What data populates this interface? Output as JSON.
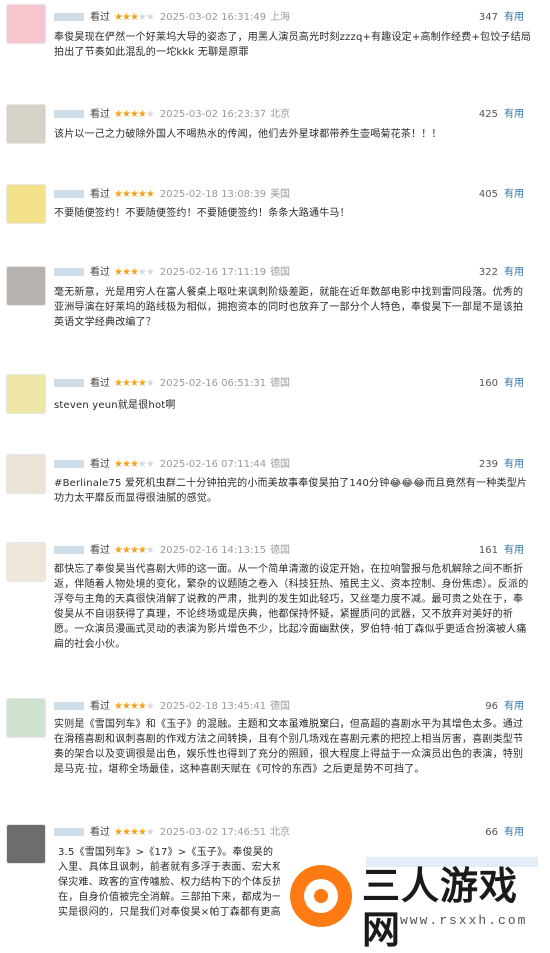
{
  "reviews": [
    {
      "seen": "看过",
      "stars": 3,
      "time": "2025-03-02 16:31:49",
      "loc": "上海",
      "votes": "347",
      "useful": "有用",
      "content": "奉俊昊现在俨然一个好莱坞大导的姿态了，用黑人演员高光时刻zzzq+有趣设定+高制作经费+包饺子结局拍出了节奏如此混乱的一坨kkk 无聊是原罪"
    },
    {
      "seen": "看过",
      "stars": 4,
      "time": "2025-03-02 16:23:37",
      "loc": "北京",
      "votes": "425",
      "useful": "有用",
      "content": "该片以一己之力破除外国人不喝热水的传闻，他们去外星球都带养生壶喝菊花茶！！！"
    },
    {
      "seen": "看过",
      "stars": 5,
      "time": "2025-02-18 13:08:39",
      "loc": "美国",
      "votes": "405",
      "useful": "有用",
      "content": "不要随便签约！不要随便签约！不要随便签约！条条大路通牛马！"
    },
    {
      "seen": "看过",
      "stars": 3,
      "time": "2025-02-16 17:11:19",
      "loc": "德国",
      "votes": "322",
      "useful": "有用",
      "content": "毫无新意，光是用穷人在富人餐桌上呕吐来讽刺阶级差距，就能在近年数部电影中找到雷同段落。优秀的亚洲导演在好莱坞的路线极为相似，拥抱资本的同时也放弃了一部分个人特色，奉俊昊下一部是不是该拍英语文学经典改编了？"
    },
    {
      "seen": "看过",
      "stars": 4,
      "time": "2025-02-16 06:51:31",
      "loc": "德国",
      "votes": "160",
      "useful": "有用",
      "content": "steven yeun就是很hot啊"
    },
    {
      "seen": "看过",
      "stars": 3,
      "time": "2025-02-16 07:11:44",
      "loc": "德国",
      "votes": "239",
      "useful": "有用",
      "content": "#Berlinale75 爱死机虫群二十分钟拍完的小而美故事奉俊昊拍了140分钟😂😂😂而且竟然有一种类型片功力太平靡反而显得很油腻的感觉。"
    },
    {
      "seen": "看过",
      "stars": 4,
      "time": "2025-02-16 14:13:15",
      "loc": "德国",
      "votes": "161",
      "useful": "有用",
      "content": "都快忘了奉俊昊当代喜剧大师的这一面。从一个简单清澈的设定开始，在拉响警报与危机解除之间不断折返，伴随着人物处境的变化，繁杂的议题随之卷入（科技狂热、殖民主义、资本控制、身份焦虑）。反派的浮夸与主角的天真很快消解了说教的严肃，批判的发生如此轻巧，又丝毫力度不减。最可贵之处在于，奉俊昊从不自诩获得了真理，不论终场或是庆典，他都保持怀疑，紧握质问的武器，又不放弃对美好的祈愿。一众演员漫画式灵动的表演为影片增色不少，比起冷面幽默侠，罗伯特·帕丁森似乎更适合扮演被人痛扁的社会小伙。"
    },
    {
      "seen": "看过",
      "stars": 4,
      "time": "2025-02-18 13:45:41",
      "loc": "德国",
      "votes": "96",
      "useful": "有用",
      "content": "实则是《雪国列车》和《玉子》的混融。主题和文本虽难脱窠臼，但高超的喜剧水平为其增色太多。通过在滑稽喜剧和讽刺喜剧的作戏方法之间转换，且有个别几场戏在喜剧元素的把控上相当厉害，喜剧类型节奏的架合以及变调很是出色，娱乐性也得到了充分的照顾，很大程度上得益于一众演员出色的表演，特别是马克·拉，堪称全场最佳，这种喜剧天赋在《可怜的东西》之后更是势不可挡了。"
    },
    {
      "seen": "看过",
      "stars": 4,
      "time": "2025-03-02 17:46:51",
      "loc": "北京",
      "votes": "66",
      "useful": "有用",
      "content": "3.5《雪国列车》>《17》>《玉子》。奉俊昊的\n入里、具体且讽刺，前者就有多浮于表面、宏大和\n保灾难、政客的宣传噱脸、权力结构下的个体反抗\n在，自身价值被完全消解。三部拍下来，都成为一\n实是很闷的，只是我们对奉俊昊×帕丁森都有更高"
    }
  ],
  "watermark": {
    "title": "三人游戏网",
    "url": "www.rsxxh.com"
  }
}
